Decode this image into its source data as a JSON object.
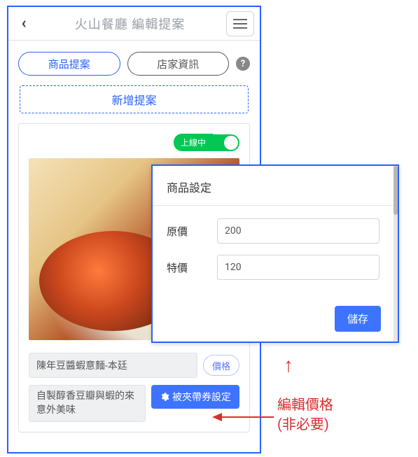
{
  "header": {
    "title": "火山餐廳 編輯提案"
  },
  "tabs": {
    "product": "商品提案",
    "store": "店家資訊"
  },
  "add_proposal": "新增提案",
  "card": {
    "status_label": "上線中",
    "product_name": "陳年豆醬蝦意麵-本廷",
    "price_button": "價格",
    "description": "自製醇香豆瓣與蝦的來意外美味",
    "coupon_button": "被夾帶券設定"
  },
  "popup": {
    "title": "商品設定",
    "original_label": "原價",
    "original_value": "200",
    "special_label": "特價",
    "special_value": "120",
    "save": "儲存"
  },
  "annotation": {
    "line1": "編輯價格",
    "line2": "(非必要)"
  }
}
